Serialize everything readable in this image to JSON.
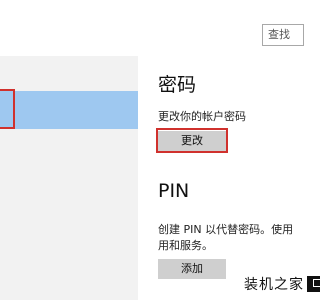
{
  "search": {
    "placeholder": "查找"
  },
  "password_section": {
    "title": "密码",
    "description": "更改你的帐户密码",
    "change_button": "更改"
  },
  "pin_section": {
    "title": "PIN",
    "description_line1": "创建 PIN 以代替密码。使用",
    "description_line2": "用和服务。",
    "add_button": "添加"
  },
  "watermark": {
    "text": "装机之家"
  },
  "colors": {
    "selected_item": "#9ec8f0",
    "highlight_border": "#d0312d",
    "button_bg": "#cfcfcf",
    "left_pane_bg": "#f2f2f2"
  }
}
